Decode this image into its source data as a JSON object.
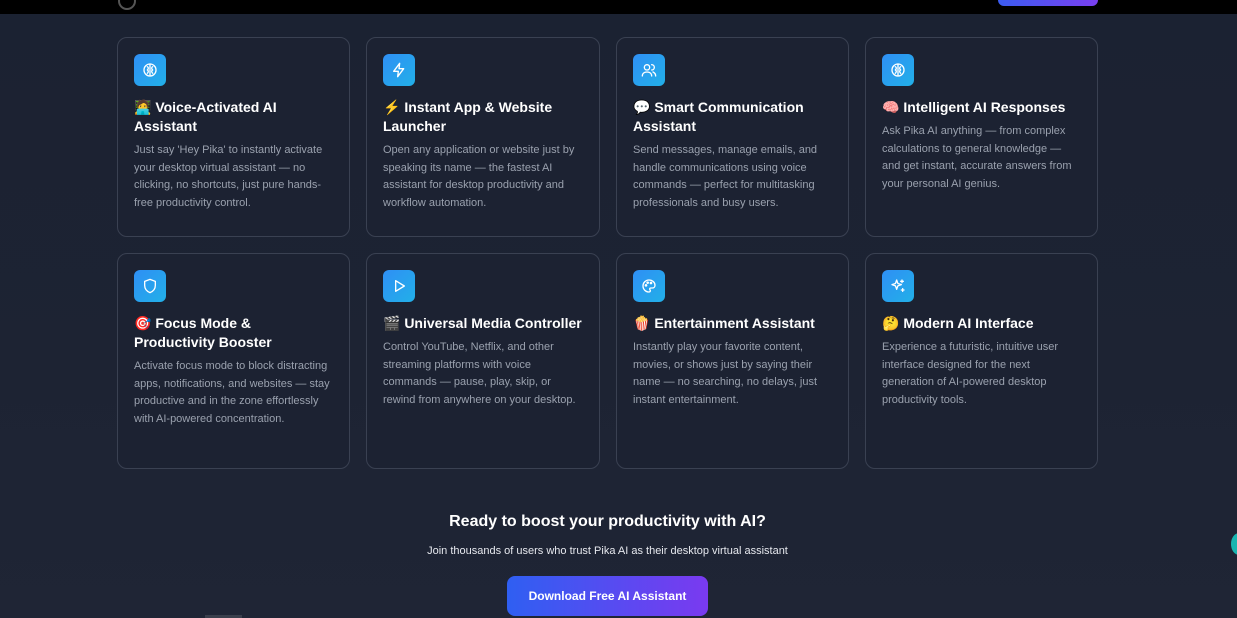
{
  "features": [
    {
      "icon": "brain-icon",
      "title": "🧑‍💻 Voice-Activated AI Assistant",
      "description": "Just say 'Hey Pika' to instantly activate your desktop virtual assistant — no clicking, no shortcuts, just pure hands-free productivity control."
    },
    {
      "icon": "lightning-icon",
      "title": "⚡ Instant App & Website Launcher",
      "description": "Open any application or website just by speaking its name — the fastest AI assistant for desktop productivity and workflow automation."
    },
    {
      "icon": "users-icon",
      "title": "💬 Smart Communication Assistant",
      "description": "Send messages, manage emails, and handle communications using voice commands — perfect for multitasking professionals and busy users."
    },
    {
      "icon": "brain-icon",
      "title": "🧠 Intelligent AI Responses",
      "description": "Ask Pika AI anything — from complex calculations to general knowledge — and get instant, accurate answers from your personal AI genius."
    },
    {
      "icon": "shield-icon",
      "title": "🎯 Focus Mode & Productivity Booster",
      "description": "Activate focus mode to block distracting apps, notifications, and websites — stay productive and in the zone effortlessly with AI-powered concentration."
    },
    {
      "icon": "play-icon",
      "title": "🎬 Universal Media Controller",
      "description": "Control YouTube, Netflix, and other streaming platforms with voice commands — pause, play, skip, or rewind from anywhere on your desktop."
    },
    {
      "icon": "palette-icon",
      "title": "🍿 Entertainment Assistant",
      "description": "Instantly play your favorite content, movies, or shows just by saying their name — no searching, no delays, just instant entertainment."
    },
    {
      "icon": "sparkles-icon",
      "title": "🤔 Modern AI Interface",
      "description": "Experience a futuristic, intuitive user interface designed for the next generation of AI-powered desktop productivity tools."
    }
  ],
  "cta": {
    "title": "Ready to boost your productivity with AI?",
    "subtitle": "Join thousands of users who trust Pika AI as their desktop virtual assistant",
    "button_label": "Download Free AI Assistant"
  },
  "colors": {
    "background": "#1c2232",
    "accent_start": "#2f5ff2",
    "accent_end": "#7a3af0",
    "icon_bg": "#2f8ff5"
  }
}
